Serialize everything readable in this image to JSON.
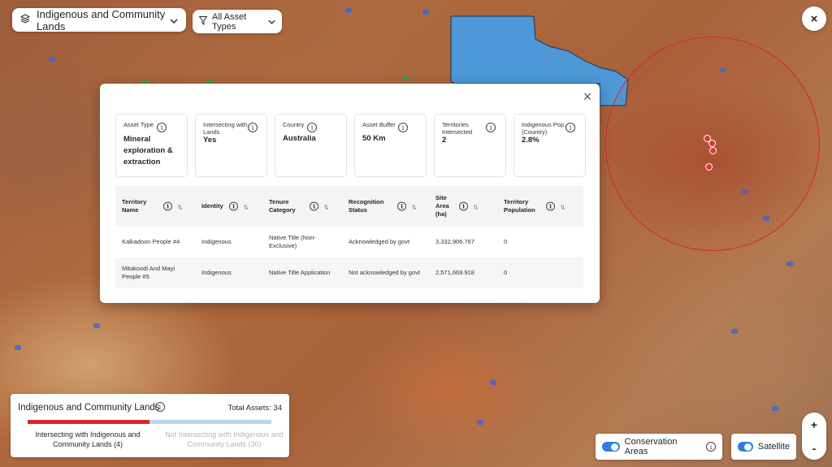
{
  "map": {
    "layer_selector": {
      "label": "Indigenous and Community Lands",
      "icon": "layers-icon",
      "caret": "chevron-down-icon"
    },
    "asset_filter": {
      "label": "All Asset Types",
      "icon": "filter-icon",
      "caret": "chevron-down-icon"
    },
    "close_label": "×",
    "territory_color": "#4a9be0",
    "buffer_color": "#d9282a",
    "marker_color": "#e03434"
  },
  "modal": {
    "close_label": "×",
    "cards": [
      {
        "label": "Asset Type",
        "value": "Mineral exploration & extraction"
      },
      {
        "label": "Intersecting with Lands",
        "value": "Yes"
      },
      {
        "label": "Country",
        "value": "Australia"
      },
      {
        "label": "Asset Buffer",
        "value": "50 Km"
      },
      {
        "label": "Territories Intersected",
        "value": "2"
      },
      {
        "label": "Indigenous Pop. (Country)",
        "value": "2.8%"
      }
    ],
    "table": {
      "columns": [
        {
          "label": "Territory Name"
        },
        {
          "label": "Identity"
        },
        {
          "label": "Tenure Category"
        },
        {
          "label": "Recognition Status"
        },
        {
          "label": "Site Area (ha)"
        },
        {
          "label": "Territory Population"
        }
      ],
      "rows": [
        [
          "Kalkadoon People #4",
          "Indigenous",
          "Native Title (Non-Exclusive)",
          "Acknowledged by govt",
          "3,332,906.767",
          "0"
        ],
        [
          "Mitakoodi And Mayi People #5",
          "Indigenous",
          "Native Title Application",
          "Not acknowledged by govt",
          "2,571,669.918",
          "0"
        ]
      ]
    }
  },
  "summary": {
    "title": "Indigenous and Community Lands",
    "total": "Total Assets: 34",
    "intersecting_label": "Intersecting with Indigenous and Community Lands (4)",
    "not_intersecting_label": "Not Intersecting with Indigenous and Community Lands (30)",
    "intersecting_color": "#d9282a",
    "not_intersecting_color": "#b9d7ee"
  },
  "toggles": {
    "conservation": {
      "label": "Conservation Areas",
      "on": true
    },
    "satellite": {
      "label": "Satellite",
      "on": true
    }
  },
  "zoom": {
    "in": "+",
    "out": "-"
  }
}
